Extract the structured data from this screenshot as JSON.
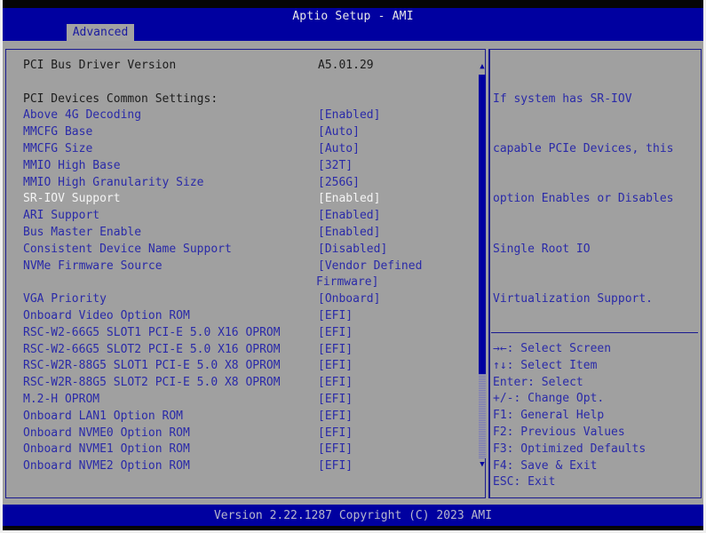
{
  "header": {
    "title": "Aptio Setup - AMI",
    "active_tab": "Advanced"
  },
  "settings": [
    {
      "label": "PCI Bus Driver Version",
      "value": "A5.01.29",
      "kind": "static"
    },
    {
      "label": "",
      "value": "",
      "kind": "blank"
    },
    {
      "label": "PCI Devices Common Settings:",
      "value": "",
      "kind": "static"
    },
    {
      "label": "Above 4G Decoding",
      "value": "[Enabled]",
      "kind": "option"
    },
    {
      "label": "MMCFG Base",
      "value": "[Auto]",
      "kind": "option"
    },
    {
      "label": "MMCFG Size",
      "value": "[Auto]",
      "kind": "option"
    },
    {
      "label": "MMIO High Base",
      "value": "[32T]",
      "kind": "option"
    },
    {
      "label": "MMIO High Granularity Size",
      "value": "[256G]",
      "kind": "option"
    },
    {
      "label": "SR-IOV Support",
      "value": "[Enabled]",
      "kind": "selected"
    },
    {
      "label": "ARI Support",
      "value": "[Enabled]",
      "kind": "option"
    },
    {
      "label": "Bus Master Enable",
      "value": "[Enabled]",
      "kind": "option"
    },
    {
      "label": "Consistent Device Name Support",
      "value": "[Disabled]",
      "kind": "option"
    },
    {
      "label": "NVMe Firmware Source",
      "value": "[Vendor Defined",
      "kind": "option"
    },
    {
      "label": "",
      "value": "Firmware]",
      "kind": "continuation"
    },
    {
      "label": "VGA Priority",
      "value": "[Onboard]",
      "kind": "option"
    },
    {
      "label": "Onboard Video Option ROM",
      "value": "[EFI]",
      "kind": "option"
    },
    {
      "label": "RSC-W2-66G5 SLOT1 PCI-E 5.0 X16 OPROM",
      "value": "[EFI]",
      "kind": "option"
    },
    {
      "label": "RSC-W2-66G5 SLOT2 PCI-E 5.0 X16 OPROM",
      "value": "[EFI]",
      "kind": "option"
    },
    {
      "label": "RSC-W2R-88G5 SLOT1 PCI-E 5.0 X8 OPROM",
      "value": "[EFI]",
      "kind": "option"
    },
    {
      "label": "RSC-W2R-88G5 SLOT2 PCI-E 5.0 X8 OPROM",
      "value": "[EFI]",
      "kind": "option"
    },
    {
      "label": "M.2-H OPROM",
      "value": "[EFI]",
      "kind": "option"
    },
    {
      "label": "Onboard LAN1 Option ROM",
      "value": "[EFI]",
      "kind": "option"
    },
    {
      "label": "Onboard NVME0 Option ROM",
      "value": "[EFI]",
      "kind": "option"
    },
    {
      "label": "Onboard NVME1 Option ROM",
      "value": "[EFI]",
      "kind": "option"
    },
    {
      "label": "Onboard NVME2 Option ROM",
      "value": "[EFI]",
      "kind": "option"
    }
  ],
  "scrollbar": {
    "up_icon": "▲",
    "down_icon": "▼",
    "visible_fraction": 0.78,
    "position": 0
  },
  "help": {
    "lines": [
      "If system has SR-IOV",
      "capable PCIe Devices, this",
      "option Enables or Disables",
      "Single Root IO",
      "Virtualization Support."
    ]
  },
  "keys": [
    {
      "key": "→←",
      "desc": ": Select Screen"
    },
    {
      "key": "↑↓",
      "desc": ": Select Item"
    },
    {
      "key": "Enter",
      "desc": ": Select"
    },
    {
      "key": "+/-",
      "desc": ": Change Opt."
    },
    {
      "key": "F1",
      "desc": ": General Help"
    },
    {
      "key": "F2",
      "desc": ": Previous Values"
    },
    {
      "key": "F3",
      "desc": ": Optimized Defaults"
    },
    {
      "key": "F4",
      "desc": ": Save & Exit"
    },
    {
      "key": "ESC",
      "desc": ": Exit"
    }
  ],
  "footer": {
    "text": "Version 2.22.1287 Copyright (C) 2023 AMI"
  },
  "colors": {
    "header_blue": "#0000a0",
    "body_gray": "#a0a0a0",
    "option_text": "#2a2aa8",
    "selected_text": "#f4f4f4",
    "static_text": "#1c1c1c"
  }
}
